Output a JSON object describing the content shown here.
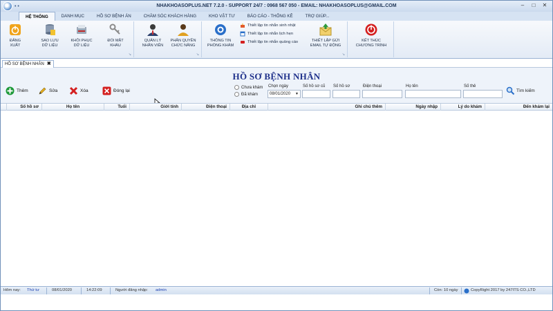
{
  "window": {
    "title": "NHAKHOASOPLUS.NET 7.2.0 - SUPPORT 24/7 : 0968 567 050 - EMAIL: NHAKHOASOPLUS@GMAIL.COM",
    "quick_access": "• •"
  },
  "tabs": [
    "HỆ THỐNG",
    "DANH MỤC",
    "HỒ SƠ BỆNH ÁN",
    "CHĂM SÓC KHÁCH HÀNG",
    "KHO VẬT TƯ",
    "BÁO CÁO - THỐNG KÊ",
    "TRỢ GIÚP..."
  ],
  "ribbon": {
    "dang_xuat": "ĐĂNG XUẤT",
    "sao_luu": [
      "SAO LƯU",
      "DỮ LIỆU"
    ],
    "khoi_phuc": [
      "KHÔI PHỤC",
      "DỮ LIỆU"
    ],
    "doi_mat_khau": [
      "ĐỔI MẬT",
      "KHẨU"
    ],
    "quan_ly_nhan_vien": [
      "QUẢN LÝ",
      "NHÂN VIÊN"
    ],
    "phan_quyen": [
      "PHÂN QUYỀN",
      "CHỨC NĂNG"
    ],
    "thong_tin_phong_kham": [
      "THÔNG TIN",
      "PHÒNG KHÁM"
    ],
    "tin_nhan_sinh_nhat": "Thiết lập tin nhắn sinh nhật",
    "tin_nhan_lich_hen": "Thiết lập tin nhắn lịch hẹn",
    "tin_nhan_quang_cao": "Thiết lập tin nhắn quảng cáo",
    "email_tu_dong": [
      "THIẾT LẬP GỬI",
      "EMAIL TỰ ĐỘNG"
    ],
    "ket_thuc": [
      "KẾT THÚC",
      "CHƯƠNG TRÌNH"
    ]
  },
  "doc_tab": {
    "label": "HỒ SƠ BỆNH NHÂN",
    "close": "✖"
  },
  "page_title": "HỒ SƠ BỆNH NHÂN",
  "actions": {
    "them": "Thêm",
    "sua": "Sửa",
    "xoa": "Xóa",
    "dong_lai": "Đóng lại"
  },
  "filters": {
    "radio_chua_kham": "Chưa khám",
    "radio_da_kham": "Đã khám",
    "chon_ngay_label": "Chọn ngày",
    "date_value": "08/01/2020",
    "so_ho_so_cu_label": "Số hồ sơ cũ",
    "so_ho_so_label": "Số hồ sơ",
    "dien_thoai_label": "Điện thoại",
    "ho_ten_label": "Họ tên",
    "so_the_label": "Số thẻ",
    "tim_kiem": "Tìm kiếm"
  },
  "grid": {
    "columns": [
      "Số hồ sơ",
      "Họ tên",
      "Tuổi",
      "Giới tính",
      "Điện thoại",
      "Địa chỉ",
      "Ghi chú thêm",
      "Ngày nhập",
      "Lý do khám",
      "Đến khám lại"
    ],
    "rows": []
  },
  "status": {
    "hom_nay_label": "Hôm nay:",
    "thu": "Thứ tư",
    "date": "08/01/2020",
    "time": "14:22:09",
    "nguoi_dang_nhap_label": "Người đăng nhập:",
    "user": "admin",
    "con_ngay": "Còn: 10 ngày",
    "copyright": "CopyRight 2017 by 247ITS CO.,LTD"
  },
  "colors": {
    "title_blue": "#1d2f8a",
    "ribbon_bg": "#e3ebf6",
    "accent_red": "#d42020",
    "accent_green": "#1f9a3a"
  }
}
